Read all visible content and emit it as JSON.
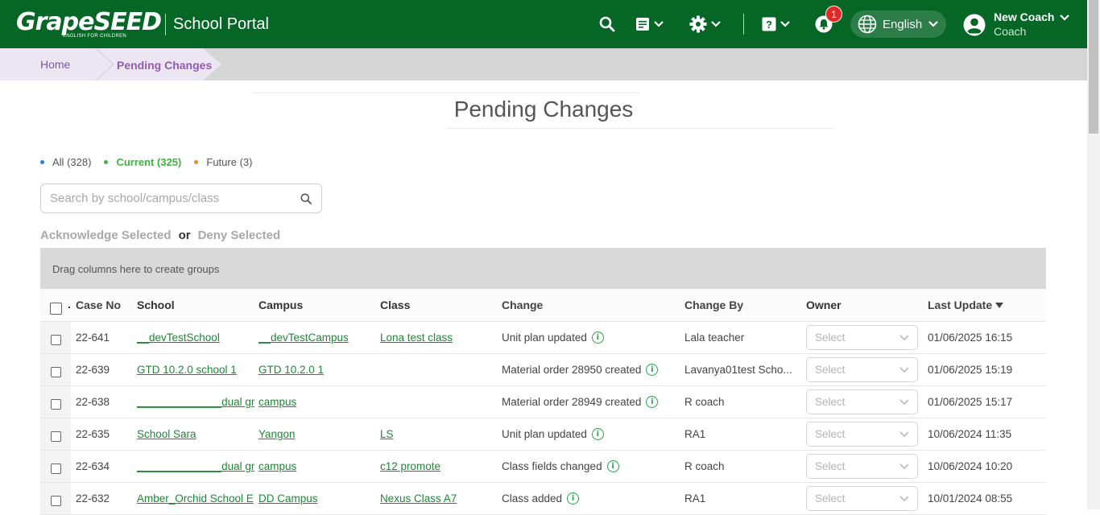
{
  "header": {
    "logo_text": "GrapeSEED",
    "logo_sub": "ENGLISH FOR CHILDREN",
    "portal_title": "School Portal",
    "notification_count": "1",
    "language": "English",
    "user_name": "New Coach",
    "user_role": "Coach"
  },
  "breadcrumb": {
    "home": "Home",
    "current": "Pending Changes"
  },
  "page_title": "Pending Changes",
  "filters": [
    {
      "label": "All",
      "count": "(328)",
      "color": "#2a7de1"
    },
    {
      "label": "Current",
      "count": "(325)",
      "color": "#3db63d"
    },
    {
      "label": "Future",
      "count": "(3)",
      "color": "#f08a1c"
    }
  ],
  "search": {
    "placeholder": "Search by school/campus/class"
  },
  "actions": {
    "acknowledge": "Acknowledge Selected",
    "or": "or",
    "deny": "Deny Selected"
  },
  "grid": {
    "group_hint": "Drag columns here to create groups",
    "columns": {
      "case_no": "Case No",
      "school": "School",
      "campus": "Campus",
      "class": "Class",
      "change": "Change",
      "change_by": "Change By",
      "owner": "Owner",
      "last_update": "Last Update"
    },
    "owner_placeholder": "Select",
    "rows": [
      {
        "case_no": "22-641",
        "school": "__devTestSchool",
        "campus": "__devTestCampus",
        "class": "Lona test class",
        "change": "Unit plan updated",
        "change_by": "Lala teacher",
        "last_update": "01/06/2025 16:15"
      },
      {
        "case_no": "22-639",
        "school": "GTD 10.2.0 school 1",
        "campus": "GTD 10.2.0 1",
        "class": "",
        "change": "Material order 28950 created",
        "change_by": "Lavanya01test Scho...",
        "last_update": "01/06/2025 15:19"
      },
      {
        "case_no": "22-638",
        "school": "______________dual grap",
        "campus": "campus",
        "class": "",
        "change": "Material order 28949 created",
        "change_by": "R coach",
        "last_update": "01/06/2025 15:17"
      },
      {
        "case_no": "22-635",
        "school": "School Sara",
        "campus": "Yangon",
        "class": "LS",
        "change": "Unit plan updated",
        "change_by": "RA1",
        "last_update": "10/06/2024 11:35"
      },
      {
        "case_no": "22-634",
        "school": "______________dual grap",
        "campus": "campus",
        "class": "c12 promote",
        "change": "Class fields changed",
        "change_by": "R coach",
        "last_update": "10/06/2024 10:20"
      },
      {
        "case_no": "22-632",
        "school": "Amber_Orchid School E",
        "campus": "DD Campus",
        "class": "Nexus Class A7",
        "change": "Class added",
        "change_by": "RA1",
        "last_update": "10/01/2024 08:55"
      }
    ]
  }
}
